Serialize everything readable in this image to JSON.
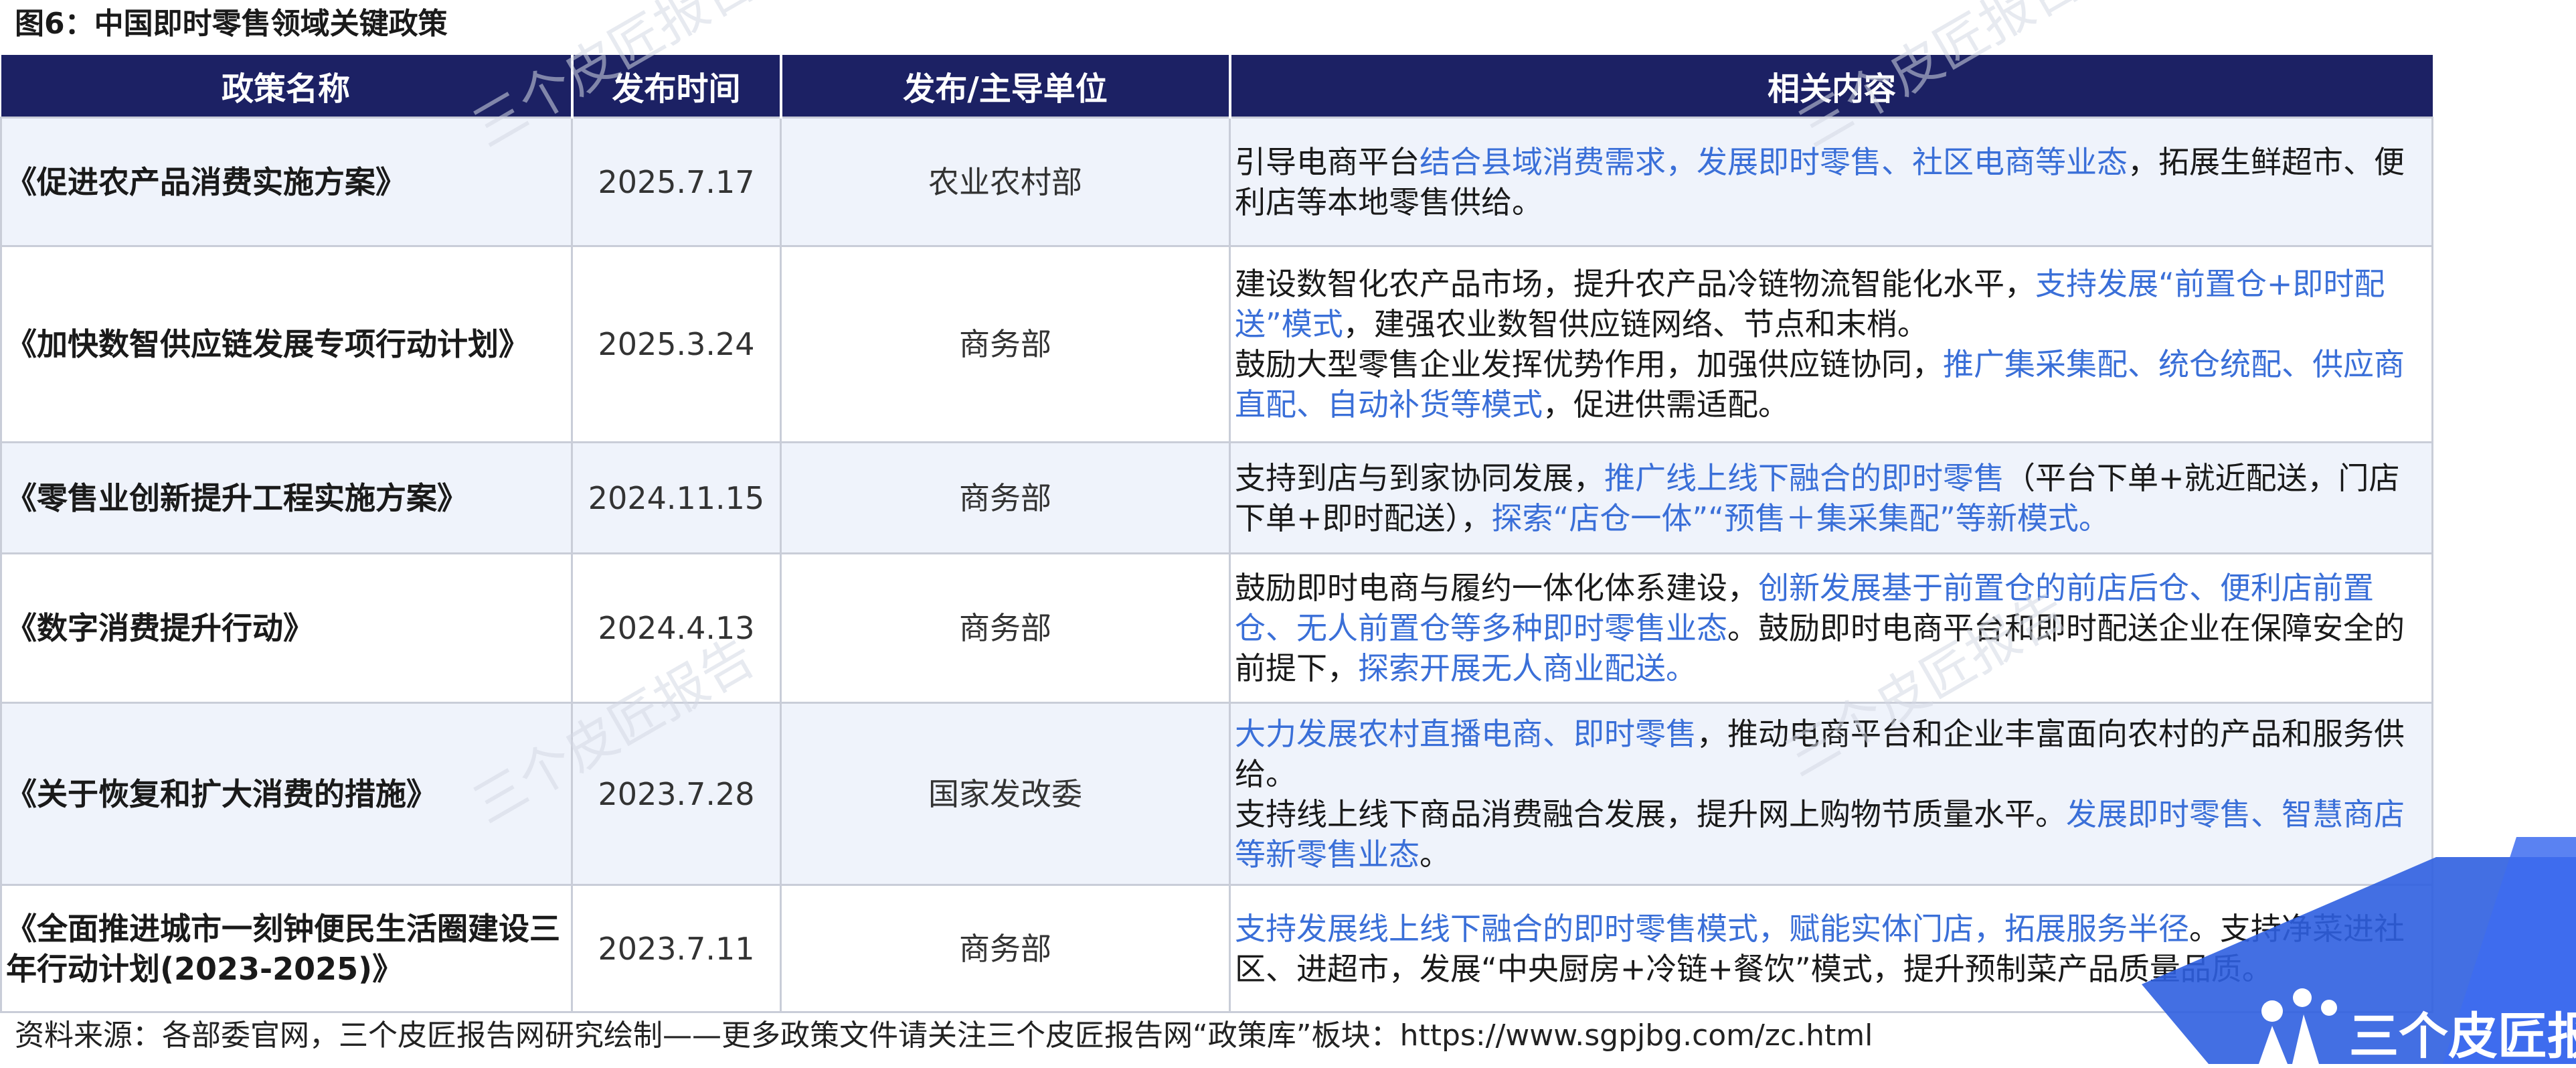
{
  "figure_title": "图6：中国即时零售领域关键政策",
  "table": {
    "headers": [
      "政策名称",
      "发布时间",
      "发布/主导单位",
      "相关内容"
    ],
    "rows": [
      {
        "name": "《促进农产品消费实施方案》",
        "date": "2025.7.17",
        "unit": "农业农村部",
        "content": [
          [
            {
              "t": "引导电商平台",
              "hl": false
            },
            {
              "t": "结合县域消费需求，发展即时零售、社区电商等业态",
              "hl": true
            },
            {
              "t": "，拓展生鲜超市、便利店等本地零售供给。",
              "hl": false
            }
          ]
        ]
      },
      {
        "name": "《加快数智供应链发展专项行动计划》",
        "date": "2025.3.24",
        "unit": "商务部",
        "content": [
          [
            {
              "t": "建设数智化农产品市场，提升农产品冷链物流智能化水平，",
              "hl": false
            },
            {
              "t": "支持发展“前置仓+即时配送”模式",
              "hl": true
            },
            {
              "t": "，建强农业数智供应链网络、节点和末梢。",
              "hl": false
            }
          ],
          [
            {
              "t": "鼓励大型零售企业发挥优势作用，加强供应链协同，",
              "hl": false
            },
            {
              "t": "推广集采集配、统仓统配、供应商直配、自动补货等模式",
              "hl": true
            },
            {
              "t": "，促进供需适配。",
              "hl": false
            }
          ]
        ]
      },
      {
        "name": "《零售业创新提升工程实施方案》",
        "date": "2024.11.15",
        "unit": "商务部",
        "content": [
          [
            {
              "t": "支持到店与到家协同发展，",
              "hl": false
            },
            {
              "t": "推广线上线下融合的即时零售",
              "hl": true
            },
            {
              "t": "（平台下单+就近配送，门店下单+即时配送），",
              "hl": false
            },
            {
              "t": "探索“店仓一体”“预售＋集采集配”等新模式。",
              "hl": true
            }
          ]
        ]
      },
      {
        "name": "《数字消费提升行动》",
        "date": "2024.4.13",
        "unit": "商务部",
        "content": [
          [
            {
              "t": "鼓励即时电商与履约一体化体系建设，",
              "hl": false
            },
            {
              "t": "创新发展基于前置仓的前店后仓、便利店前置仓、无人前置仓等多种即时零售业态",
              "hl": true
            },
            {
              "t": "。鼓励即时电商平台和即时配送企业在保障安全的前提下，",
              "hl": false
            },
            {
              "t": "探索开展无人商业配送。",
              "hl": true
            }
          ]
        ]
      },
      {
        "name": "《关于恢复和扩大消费的措施》",
        "date": "2023.7.28",
        "unit": "国家发改委",
        "content": [
          [
            {
              "t": "大力发展农村直播电商、即时零售",
              "hl": true
            },
            {
              "t": "，推动电商平台和企业丰富面向农村的产品和服务供给。",
              "hl": false
            }
          ],
          [
            {
              "t": "支持线上线下商品消费融合发展，提升网上购物节质量水平。",
              "hl": false
            },
            {
              "t": "发展即时零售、智慧商店等新零售业态",
              "hl": true
            },
            {
              "t": "。",
              "hl": false
            }
          ]
        ]
      },
      {
        "name": "《全面推进城市一刻钟便民生活圈建设三年行动计划(2023-2025)》",
        "date": "2023.7.11",
        "unit": "商务部",
        "content": [
          [
            {
              "t": "支持发展线上线下融合的即时零售模式，赋能实体门店，拓展服务半径",
              "hl": true
            },
            {
              "t": "。支持净菜进社区、进超市，发展“中央厨房+冷链+餐饮”模式，提升预制菜产品质量品质。",
              "hl": false
            }
          ]
        ]
      }
    ]
  },
  "source_note": "资料来源：各部委官网，三个皮匠报告网研究绘制——更多政策文件请关注三个皮匠报告网“政策库”板块：https://www.sgpjbg.com/zc.html",
  "watermark_text": "三个皮匠报告",
  "brand": {
    "name": "三个皮匠报告",
    "accent_color": "#2f5fe0",
    "header_color": "#1c2164",
    "highlight_color": "#3a6fd8"
  }
}
